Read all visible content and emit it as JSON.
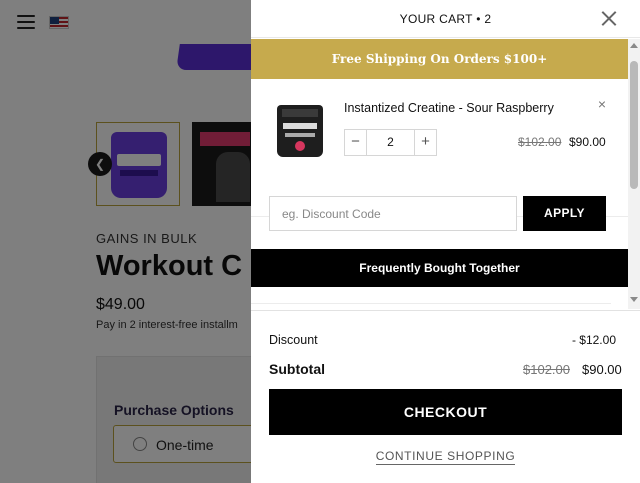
{
  "background_page": {
    "menu_icon": "hamburger-icon",
    "flag_icon": "us-flag-icon",
    "brand": "GAINS IN BULK",
    "product_title": "Workout C",
    "price": "$49.00",
    "installments": "Pay in 2 interest-free installm",
    "purchase_options_title": "Purchase Options",
    "option_one_time": "One-time",
    "prev_arrow": "❮"
  },
  "cart": {
    "title": "YOUR CART • 2",
    "close_icon": "close-icon",
    "shipping_banner": "Free Shipping On Orders $100+",
    "items": [
      {
        "name": "Instantized Creatine - Sour Raspberry",
        "quantity": "2",
        "old_price": "$102.00",
        "new_price": "$90.00",
        "remove_icon": "×"
      }
    ],
    "discount_placeholder": "eg. Discount Code",
    "apply_label": "APPLY",
    "fbt_label": "Frequently Bought Together",
    "summary": {
      "discount_label": "Discount",
      "discount_value": "- $12.00",
      "subtotal_label": "Subtotal",
      "subtotal_old": "$102.00",
      "subtotal_new": "$90.00"
    },
    "checkout_label": "CHECKOUT",
    "continue_label": "CONTINUE SHOPPING"
  },
  "colors": {
    "shipping_banner_bg": "#c6aa4d",
    "button_bg": "#000000",
    "overlay": "rgba(0,0,0,0.5)"
  }
}
